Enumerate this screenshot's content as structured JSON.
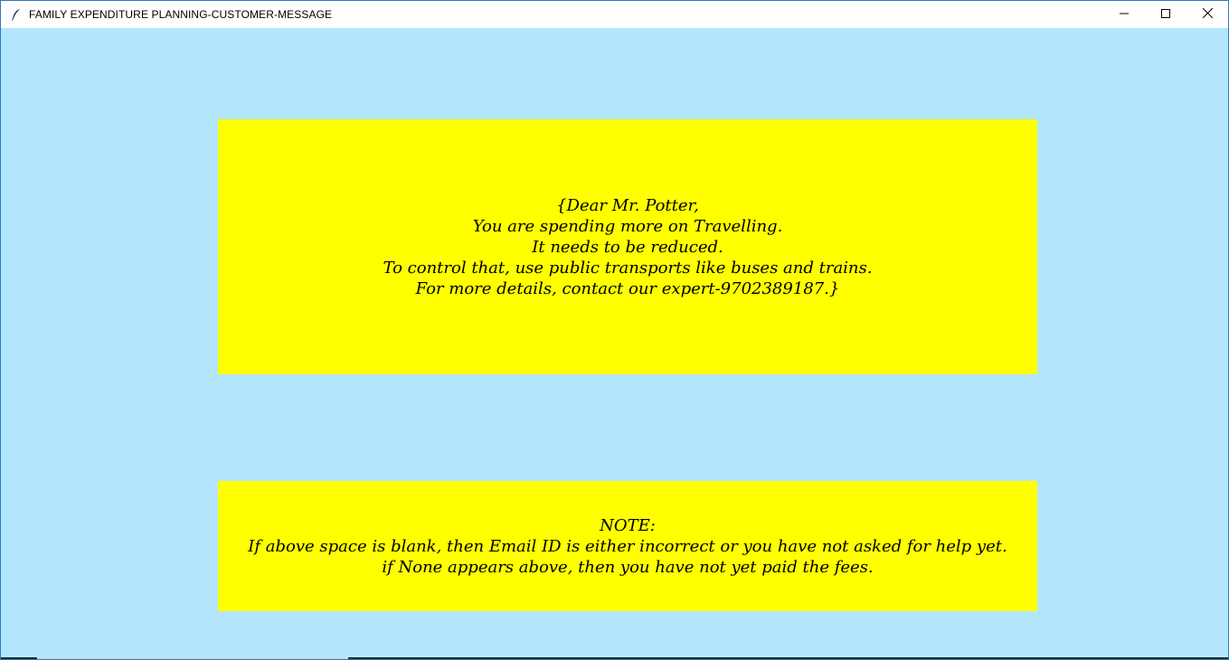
{
  "window": {
    "title": "FAMILY EXPENDITURE PLANNING-CUSTOMER-MESSAGE",
    "app_icon": "feather-icon",
    "controls": [
      "minimize-icon",
      "maximize-icon",
      "close-icon"
    ]
  },
  "colors": {
    "background": "#b3e6fd",
    "panel": "#ffff00",
    "text": "#000000"
  },
  "message": {
    "text": "{Dear Mr. Potter,\nYou are spending more on Travelling.\nIt needs to be reduced.\nTo control that, use public transports like buses and trains.\nFor more details, contact our expert-9702389187.}"
  },
  "note": {
    "text": "NOTE:\nIf above space is blank, then Email ID is either incorrect or you have not asked for help yet.\nif None appears above, then you have not yet paid the fees."
  }
}
